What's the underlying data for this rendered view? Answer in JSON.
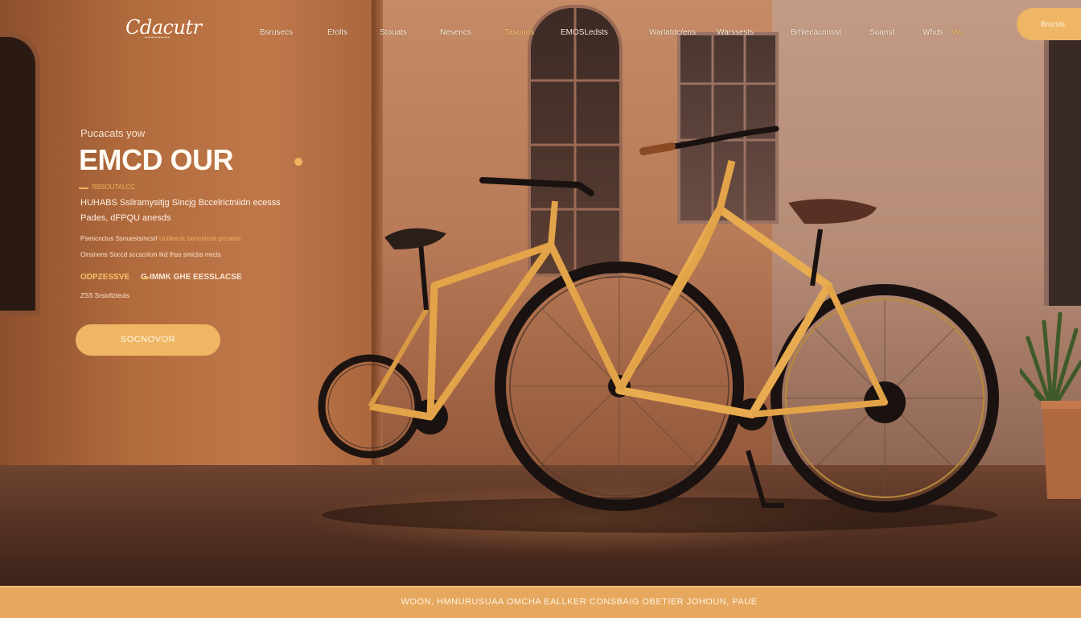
{
  "brand": {
    "logo_text": "Cdacutr"
  },
  "nav": {
    "items": [
      {
        "label": "Bsrusecs"
      },
      {
        "label": "Etolts"
      },
      {
        "label": "Stouats"
      },
      {
        "label": "Nesencs"
      },
      {
        "label": "Tasonos",
        "active": true
      },
      {
        "label": "EMOSLedsts"
      },
      {
        "label": "Warlatdc/ens"
      },
      {
        "label": "Warssests"
      },
      {
        "label": "Brhlecaconsst"
      },
      {
        "label": "Suanst"
      },
      {
        "label": "Whds"
      },
      {
        "label": "Mo",
        "active": true
      }
    ],
    "cta_label": "Brocsts"
  },
  "hero": {
    "eyebrow": "Pucacats yow",
    "headline": "EMCD OUR",
    "tagline": "RBSOUTALCC",
    "description_line1": "HUHABS Ssilramysitjg Sincjg Bccelrictniidn ecesss",
    "description_line2": "Pades, dFPQU anesds",
    "detail_line1_a": "Pseocnctus Ssnuestsmcsrl ",
    "detail_line1_b": "Ucdeeclc benceinse pccaets",
    "detail_line2": "Oirsinens Soccd sccscrlcm Ikd Ihss smicbs rrects",
    "promo_code": "ODPZESSVE",
    "promo_text": "G-IMMK GHE EESSLACSE",
    "small_note": "ZSS Srsioflzleuts",
    "button_label": "SOCNOVOR"
  },
  "footer": {
    "text": "WOON, HMNURUSUAA OMCHA EALLKER CONSBAIG OBETIER JOHOUN, PAUE"
  },
  "colors": {
    "accent": "#efb665",
    "accent_text": "#f0b25e",
    "footer_bg": "#e6a75e"
  }
}
